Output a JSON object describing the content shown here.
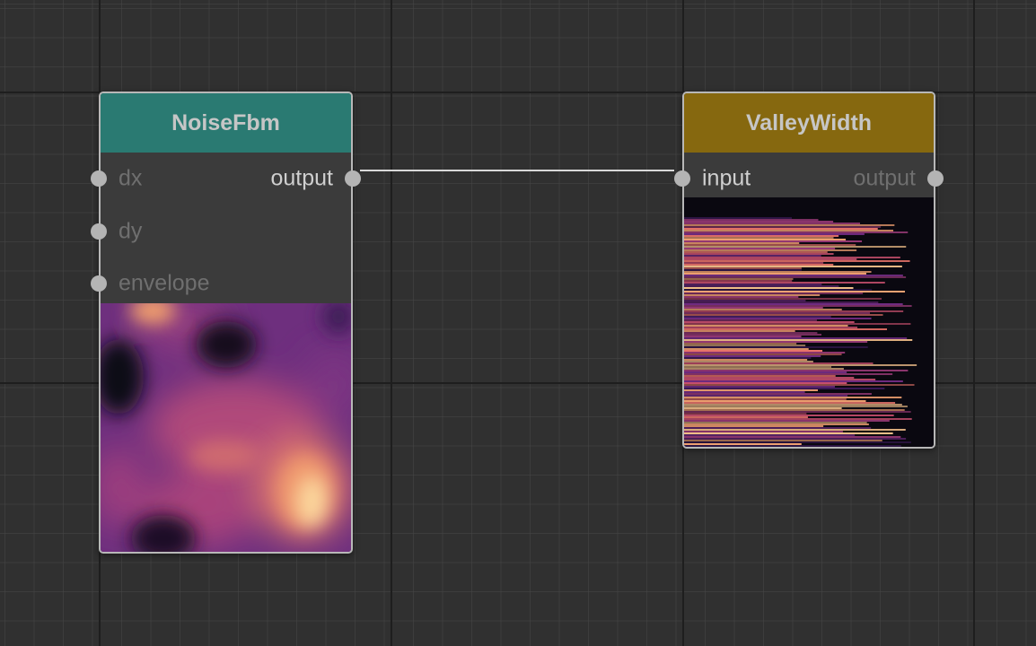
{
  "colors": {
    "canvas_background": "#303030",
    "grid_major": "#1e1e1e",
    "node_body": "#3b3b3b",
    "node_border": "#b8b8b8",
    "noise_header": "#2a7a72",
    "valley_header": "#86680f",
    "wire": "#d8d8d8",
    "socket": "#b4b4b4"
  },
  "nodes": {
    "noise": {
      "title": "NoiseFbm",
      "inputs": [
        "dx",
        "dy",
        "envelope"
      ],
      "output": "output",
      "preview": "noise-heatmap-preview"
    },
    "valley": {
      "title": "ValleyWidth",
      "input": "input",
      "output": "output",
      "preview": "valley-streak-preview"
    }
  },
  "connections": [
    {
      "from": "NoiseFbm.output",
      "to": "ValleyWidth.input"
    }
  ]
}
